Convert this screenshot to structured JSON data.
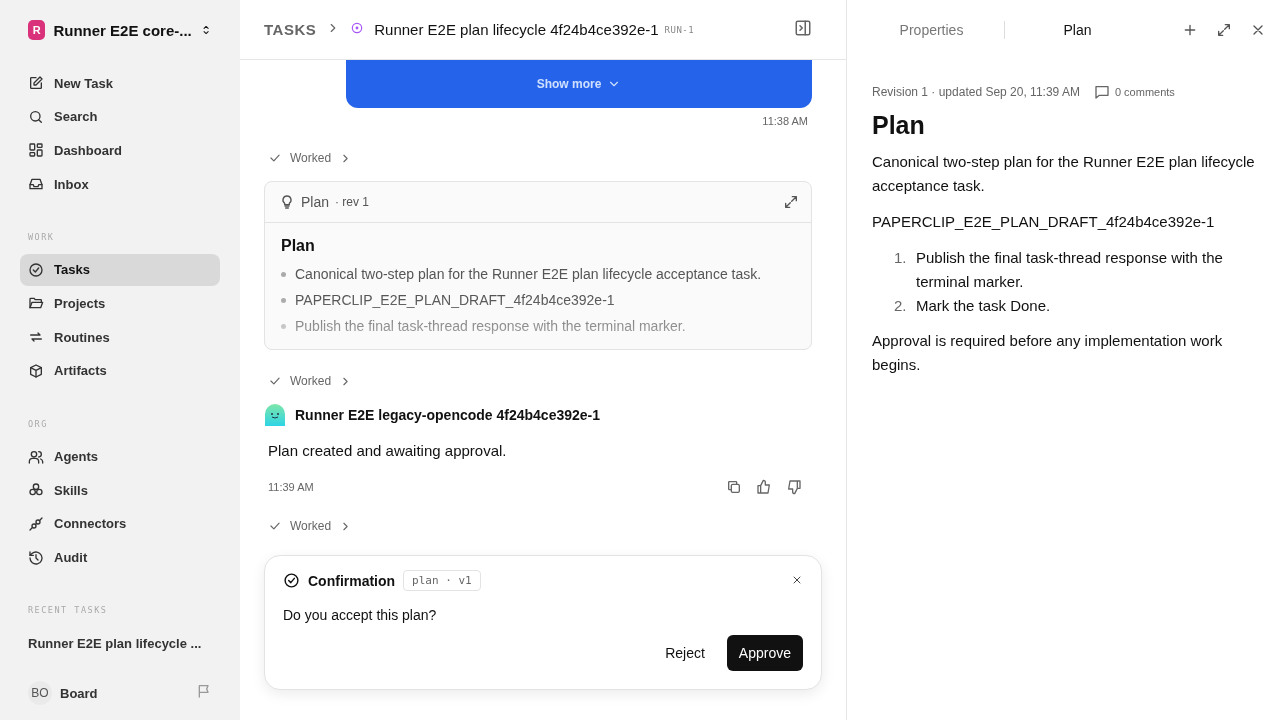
{
  "workspace": {
    "initial": "R",
    "name": "Runner E2E core-..."
  },
  "sidebar": {
    "top_items": [
      {
        "label": "New Task",
        "selected": false
      },
      {
        "label": "Search",
        "selected": false
      },
      {
        "label": "Dashboard",
        "selected": false
      },
      {
        "label": "Inbox",
        "selected": false
      }
    ],
    "sections": [
      {
        "title": "WORK",
        "items": [
          {
            "label": "Tasks",
            "selected": true
          },
          {
            "label": "Projects",
            "selected": false
          },
          {
            "label": "Routines",
            "selected": false
          },
          {
            "label": "Artifacts",
            "selected": false
          }
        ]
      },
      {
        "title": "ORG",
        "items": [
          {
            "label": "Agents",
            "selected": false
          },
          {
            "label": "Skills",
            "selected": false
          },
          {
            "label": "Connectors",
            "selected": false
          },
          {
            "label": "Audit",
            "selected": false
          }
        ]
      }
    ],
    "recent_title": "RECENT TASKS",
    "recent_items": [
      "Runner E2E plan lifecycle ..."
    ],
    "user": {
      "initials": "BO",
      "name": "Board"
    }
  },
  "breadcrumb": {
    "root": "TASKS",
    "title": "Runner E2E plan lifecycle 4f24b4ce392e-1",
    "id": "RUN-1"
  },
  "thread": [
    {
      "kind": "user_bubble",
      "action": "Show more",
      "time": "11:38 AM"
    },
    {
      "kind": "worked",
      "label": "Worked"
    },
    {
      "kind": "plan_card",
      "title": "Plan",
      "rev": "· rev 1",
      "heading": "Plan",
      "bullets": [
        "Canonical two-step plan for the Runner E2E plan lifecycle acceptance task.",
        "PAPERCLIP_E2E_PLAN_DRAFT_4f24b4ce392e-1",
        "Publish the final task-thread response with the terminal marker."
      ]
    },
    {
      "kind": "worked",
      "label": "Worked"
    },
    {
      "kind": "agent_message",
      "author": "Runner E2E legacy-opencode 4f24b4ce392e-1",
      "text": "Plan created and awaiting approval.",
      "time": "11:39 AM"
    },
    {
      "kind": "worked",
      "label": "Worked"
    }
  ],
  "confirmation": {
    "title": "Confirmation",
    "tag": "plan · v1",
    "question": "Do you accept this plan?",
    "buttons": [
      "Reject",
      "Approve"
    ]
  },
  "panel": {
    "tabs": [
      {
        "label": "Properties",
        "selected": false
      },
      {
        "label": "Plan",
        "selected": true
      }
    ],
    "meta": "Revision 1 · updated Sep 20, 11:39 AM",
    "comments": "0 comments",
    "title": "Plan",
    "intro": "Canonical two-step plan for the Runner E2E plan lifecycle acceptance task.",
    "marker": "PAPERCLIP_E2E_PLAN_DRAFT_4f24b4ce392e-1",
    "steps": [
      {
        "number": "1.",
        "text": "Publish the final task-thread response with the terminal marker."
      },
      {
        "number": "2.",
        "text": "Mark the task Done."
      }
    ],
    "outro": "Approval is required before any implementation work begins."
  }
}
